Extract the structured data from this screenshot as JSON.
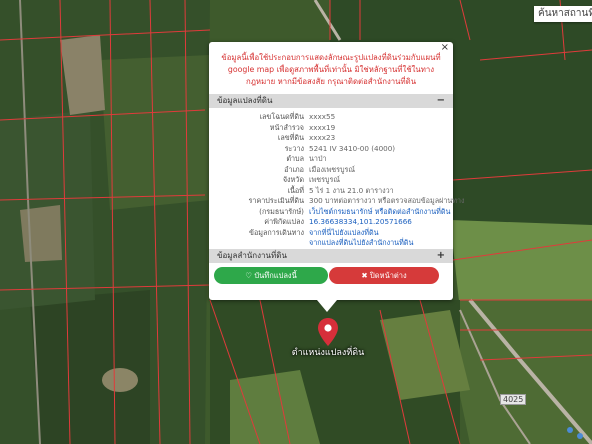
{
  "top_search": {
    "text": "ค้นหาสถานที่สำคัญ"
  },
  "map": {
    "road_label": "4025",
    "pin_label": "ตำแหน่งแปลงที่ดิน"
  },
  "popup": {
    "close_symbol": "×",
    "warning": "ข้อมูลนี้เพื่อใช้ประกอบการแสดงลักษณะรูปแปลงที่ดินร่วมกับแผนที่ google map เพื่อดูสภาพพื้นที่เท่านั้น มิใช่หลักฐานที่ใช้ในทางกฎหมาย หากมีข้อสงสัย กรุณาติดต่อสำนักงานที่ดิน",
    "section1": {
      "title": "ข้อมูลแปลงที่ดิน",
      "toggle": "−"
    },
    "rows": [
      {
        "label": "เลขโฉนดที่ดิน",
        "value": "xxxx55"
      },
      {
        "label": "หน้าสำรวจ",
        "value": "xxxx19"
      },
      {
        "label": "เลขที่ดิน",
        "value": "xxxx23"
      },
      {
        "label": "ระวาง",
        "value": "5241 IV 3410-00 (4000)"
      },
      {
        "label": "ตำบล",
        "value": "นาป่า"
      },
      {
        "label": "อำเภอ",
        "value": "เมืองเพชรบูรณ์"
      },
      {
        "label": "จังหวัด",
        "value": "เพชรบูรณ์"
      },
      {
        "label": "เนื้อที่",
        "value": "5 ไร่ 1 งาน 21.0 ตารางวา"
      },
      {
        "label": "ราคาประเมินที่ดิน",
        "value": "300 บาทต่อตารางวา หรือตรวจสอบข้อมูลผ่านทาง"
      },
      {
        "label": "(กรมธนารักษ์)",
        "value": "เว็บไซต์กรมธนารักษ์ หรือติดต่อสำนักงานที่ดิน",
        "link": true
      },
      {
        "label": "ค่าพิกัดแปลง",
        "value": "16.36638334,101.20571666",
        "link": true
      },
      {
        "label": "ข้อมูลการเดินทาง",
        "value": "จากที่นี่ไปยังแปลงที่ดิน",
        "link": true
      },
      {
        "label": "",
        "value": "จากแปลงที่ดินไปยังสำนักงานที่ดิน",
        "link": true
      }
    ],
    "section2": {
      "title": "ข้อมูลสำนักงานที่ดิน",
      "toggle": "+"
    },
    "save_button": "♡ บันทึกแปลงนี้",
    "close_button": "✖ ปิดหน้าต่าง"
  }
}
